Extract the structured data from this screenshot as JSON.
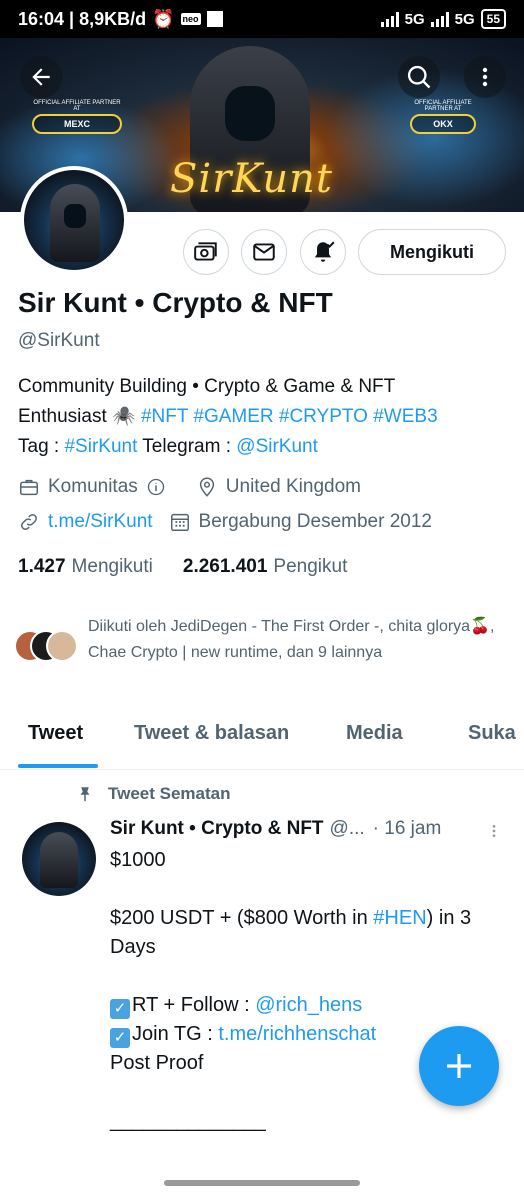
{
  "status_bar": {
    "time_speed": "16:04 | 8,9KB/d",
    "network_1": "5G",
    "network_2": "5G",
    "battery": "55"
  },
  "banner": {
    "script_text": "SirKunt",
    "partner_left_caption": "OFFICIAL AFFILIATE PARTNER AT",
    "partner_left_brand": "MEXC",
    "partner_right_caption": "OFFICIAL AFFILIATE PARTNER AT",
    "partner_right_brand": "OKX"
  },
  "profile": {
    "name": "Sir Kunt • Crypto & NFT",
    "handle": "@SirKunt",
    "follow_button": "Mengikuti",
    "bio": {
      "line1": "Community Building • Crypto & Game & NFT",
      "line2_text": "Enthusiast 🕷️",
      "hashtags": "#NFT #GAMER #CRYPTO #WEB3",
      "line3_prefix": "Tag : ",
      "tag_link": "#SirKunt",
      "line3_mid": " Telegram : ",
      "telegram_link": "@SirKunt"
    },
    "category": "Komunitas",
    "location": "United Kingdom",
    "website": "t.me/SirKunt",
    "joined": "Bergabung Desember 2012",
    "following_count": "1.427",
    "following_label": "Mengikuti",
    "followers_count": "2.261.401",
    "followers_label": "Pengikut",
    "followed_by": "Diikuti oleh JediDegen - The First Order -, chita glorya🍒, Chae Crypto | new runtime, dan 9 lainnya"
  },
  "tabs": [
    {
      "label": "Tweet"
    },
    {
      "label": "Tweet & balasan"
    },
    {
      "label": "Media"
    },
    {
      "label": "Suka"
    }
  ],
  "pinned_tweet": {
    "pinned_label": "Tweet Sematan",
    "author_name": "Sir Kunt • Crypto & NFT",
    "author_handle": "@...",
    "time": "· 16 jam",
    "line1": "$1000",
    "line2_prefix": "$200 USDT + ($800 Worth in ",
    "line2_link": "#HEN",
    "line2_suffix": ") in 3 Days",
    "line3_prefix": "RT + Follow : ",
    "line3_link": "@rich_hens",
    "line4_prefix": "Join TG : ",
    "line4_link": "t.me/richhenschat",
    "line5": "Post Proof",
    "line6": "______________"
  },
  "colors": {
    "accent": "#1d9bf0",
    "text_primary": "#0f1419",
    "text_secondary": "#536471"
  }
}
